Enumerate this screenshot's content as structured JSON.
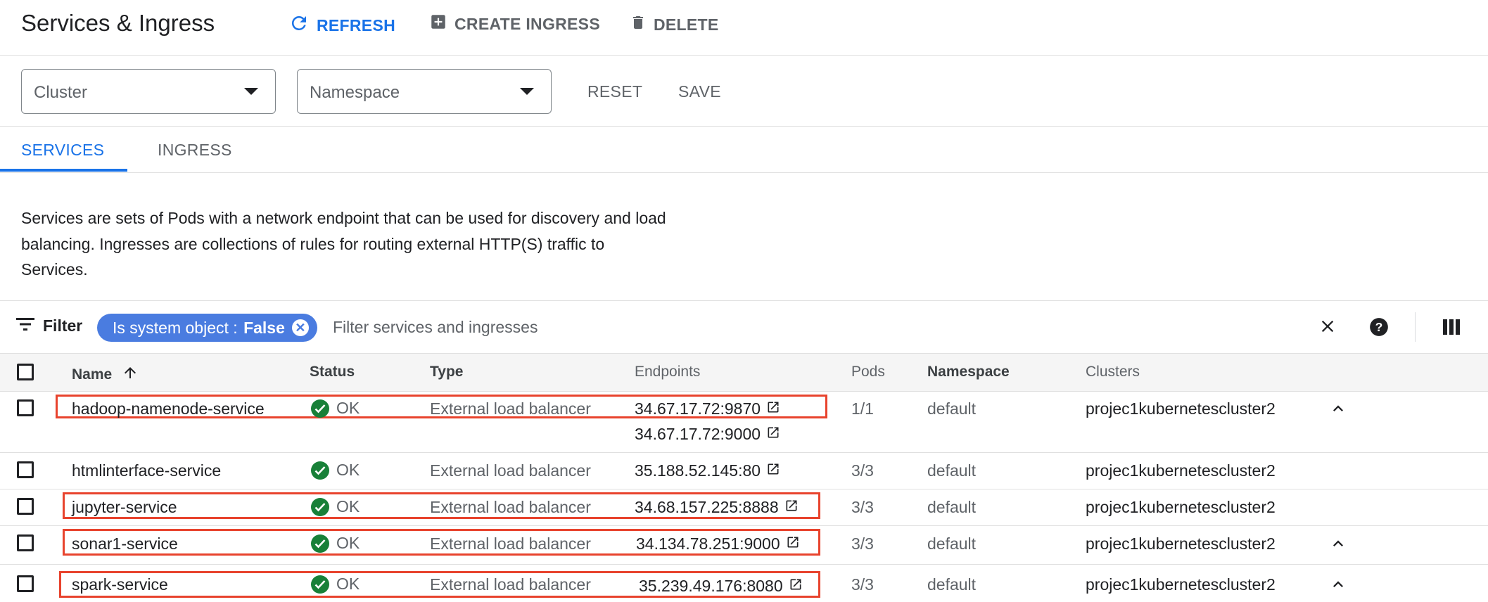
{
  "header": {
    "title": "Services & Ingress",
    "refresh_label": "REFRESH",
    "create_label": "CREATE INGRESS",
    "delete_label": "DELETE"
  },
  "filters": {
    "cluster_placeholder": "Cluster",
    "namespace_placeholder": "Namespace",
    "reset_label": "RESET",
    "save_label": "SAVE"
  },
  "tabs": [
    {
      "label": "SERVICES",
      "active": true
    },
    {
      "label": "INGRESS",
      "active": false
    }
  ],
  "description": "Services are sets of Pods with a network endpoint that can be used for discovery and load balancing. Ingresses are collections of rules for routing external HTTP(S) traffic to Services.",
  "filter_bar": {
    "filter_label": "Filter",
    "chip_key": "Is system object : ",
    "chip_value": "False",
    "placeholder": "Filter services and ingresses"
  },
  "table": {
    "columns": [
      "Name",
      "Status",
      "Type",
      "Endpoints",
      "Pods",
      "Namespace",
      "Clusters"
    ],
    "rows": [
      {
        "name": "hadoop-namenode-service",
        "status": "OK",
        "type": "External load balancer",
        "endpoints": [
          "34.67.17.72:9870",
          "34.67.17.72:9000"
        ],
        "pods": "1/1",
        "namespace": "default",
        "cluster": "projec1kubernetescluster2"
      },
      {
        "name": "htmlinterface-service",
        "status": "OK",
        "type": "External load balancer",
        "endpoints": [
          "35.188.52.145:80"
        ],
        "pods": "3/3",
        "namespace": "default",
        "cluster": "projec1kubernetescluster2"
      },
      {
        "name": "jupyter-service",
        "status": "OK",
        "type": "External load balancer",
        "endpoints": [
          "34.68.157.225:8888"
        ],
        "pods": "3/3",
        "namespace": "default",
        "cluster": "projec1kubernetescluster2"
      },
      {
        "name": "sonar1-service",
        "status": "OK",
        "type": "External load balancer",
        "endpoints": [
          "34.134.78.251:9000"
        ],
        "pods": "3/3",
        "namespace": "default",
        "cluster": "projec1kubernetescluster2"
      },
      {
        "name": "spark-service",
        "status": "OK",
        "type": "External load balancer",
        "endpoints": [
          "35.239.49.176:8080"
        ],
        "pods": "3/3",
        "namespace": "default",
        "cluster": "projec1kubernetescluster2"
      }
    ]
  },
  "colors": {
    "accent": "#1a73e8",
    "chip": "#4a7ce0",
    "status_ok": "#188038",
    "highlight_box": "#e8432d"
  }
}
